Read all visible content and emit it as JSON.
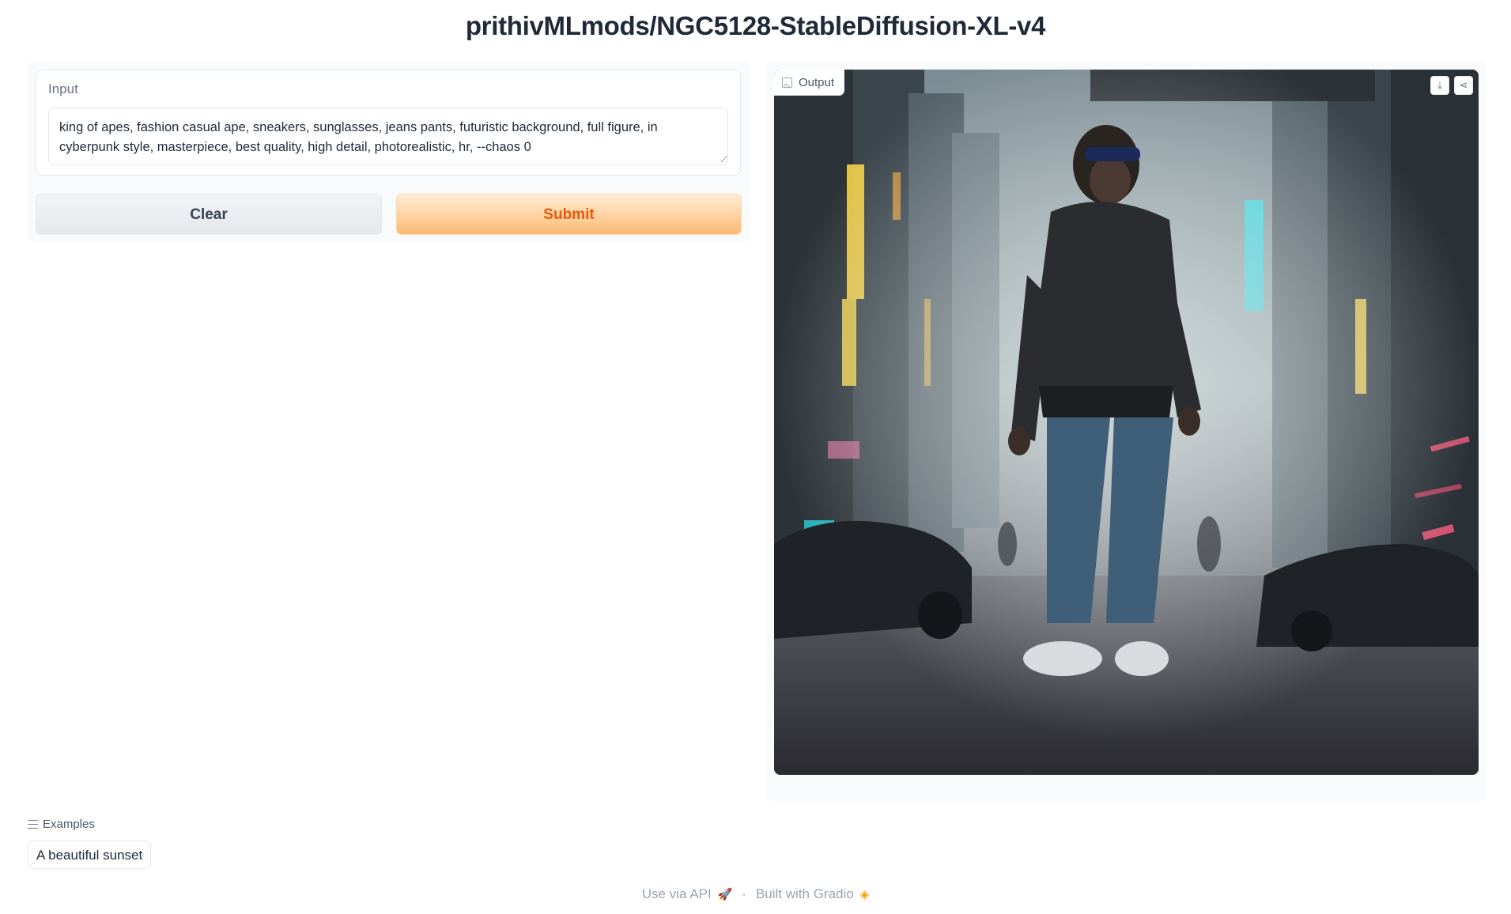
{
  "page": {
    "title": "prithivMLmods/NGC5128-StableDiffusion-XL-v4"
  },
  "input": {
    "label": "Input",
    "value": "king of apes, fashion casual ape, sneakers, sunglasses, jeans pants, futuristic background, full figure, in cyberpunk style, masterpiece, best quality, high detail, photorealistic, hr, --chaos 0"
  },
  "buttons": {
    "clear_label": "Clear",
    "submit_label": "Submit"
  },
  "output": {
    "label": "Output",
    "icons": [
      "image-icon",
      "download-icon",
      "share-icon"
    ]
  },
  "examples": {
    "header": "Examples",
    "items": [
      {
        "label": "A beautiful sunset"
      }
    ]
  },
  "footer": {
    "api_label": "Use via API",
    "separator": "·",
    "built_label": "Built with Gradio"
  },
  "colors": {
    "accent": "#ea580c",
    "submit_bg": "#fdba74",
    "panel_bg": "#f9fafb"
  }
}
